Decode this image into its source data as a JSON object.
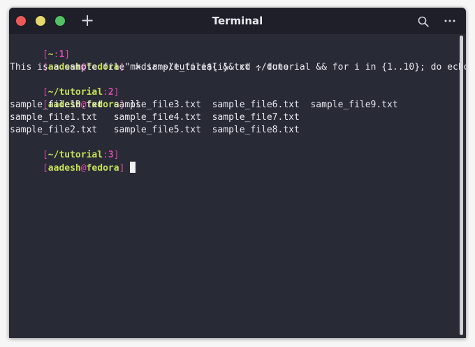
{
  "window": {
    "title": "Terminal",
    "icons": {
      "close": "close-dot",
      "minimize": "minimize-dot",
      "maximize": "maximize-dot",
      "new_tab": "plus-icon",
      "search": "search-icon",
      "menu": "ellipsis-icon"
    },
    "new_tab_glyph": "+",
    "colors": {
      "background": "#282a36",
      "titlebar": "#1e1f28",
      "bracket": "#d94aa8",
      "prompt_green": "#c6e057",
      "close": "#ec5a57",
      "minimize": "#e6d86b",
      "maximize": "#52c262"
    }
  },
  "terminal": {
    "prompt1": {
      "open": "[",
      "path": "~",
      "colon": ":",
      "num": "1",
      "close": "]"
    },
    "user_line1": {
      "open": "[",
      "user": "aadesh",
      "at": "@",
      "host": "fedora",
      "close": "]",
      "command": " mkdir ~/tutorial && cd ~/tutorial && for i in {1..10}; do echo \""
    },
    "wrap_line": "This is a sample file\" > sample_file${i}.txt ; done",
    "prompt2": {
      "open": "[",
      "path": "~/tutorial",
      "colon": ":",
      "num": "2",
      "close": "]"
    },
    "user_line2": {
      "open": "[",
      "user": "aadesh",
      "at": "@",
      "host": "fedora",
      "close": "]",
      "command": " ls"
    },
    "ls_output": [
      "sample_file10.txt  sample_file3.txt  sample_file6.txt  sample_file9.txt",
      "sample_file1.txt   sample_file4.txt  sample_file7.txt",
      "sample_file2.txt   sample_file5.txt  sample_file8.txt"
    ],
    "prompt3": {
      "open": "[",
      "path": "~/tutorial",
      "colon": ":",
      "num": "3",
      "close": "]"
    },
    "user_line3": {
      "open": "[",
      "user": "aadesh",
      "at": "@",
      "host": "fedora",
      "close": "]",
      "command": " "
    }
  }
}
